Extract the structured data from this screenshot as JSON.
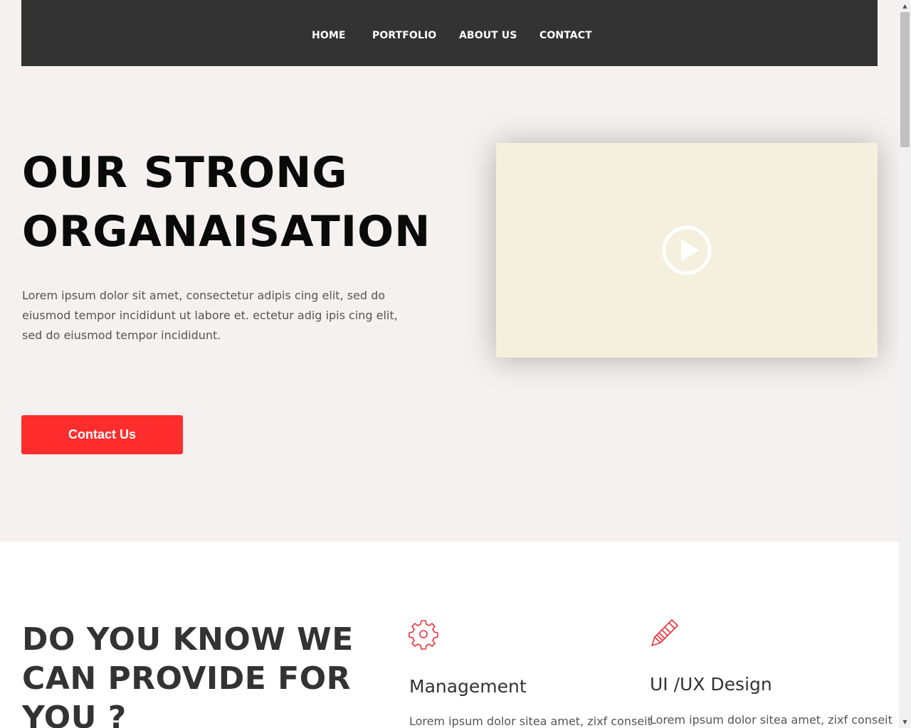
{
  "nav": {
    "items": [
      {
        "label": "HOME"
      },
      {
        "label": "PORTFOLIO"
      },
      {
        "label": "ABOUT US"
      },
      {
        "label": "CONTACT"
      }
    ]
  },
  "hero": {
    "title_line1": "OUR STRONG",
    "title_line2": "ORGANAISATION",
    "text": "Lorem ipsum dolor sit amet, consectetur adipis cing elit, sed do eiusmod tempor incididunt ut labore et. ectetur adig ipis cing elit, sed do eiusmod tempor incididunt.",
    "button_label": "Contact Us",
    "video_icon": "play-circle-icon"
  },
  "services": {
    "title_line1": "DO YOU KNOW WE",
    "title_line2": "CAN PROVIDE FOR",
    "title_line3": "YOU ?",
    "items": [
      {
        "icon": "gear-icon",
        "title": "Management",
        "text": "Lorem ipsum dolor sitea amet, zixf conseit"
      },
      {
        "icon": "pencil-icon",
        "title": "UI /UX Design",
        "text": "Lorem ipsum dolor sitea amet, zixf conseit"
      }
    ]
  },
  "colors": {
    "nav_bg": "#333333",
    "hero_bg": "#f5f1f0",
    "accent": "#ff2d2d",
    "video_bg": "#f5efde"
  }
}
